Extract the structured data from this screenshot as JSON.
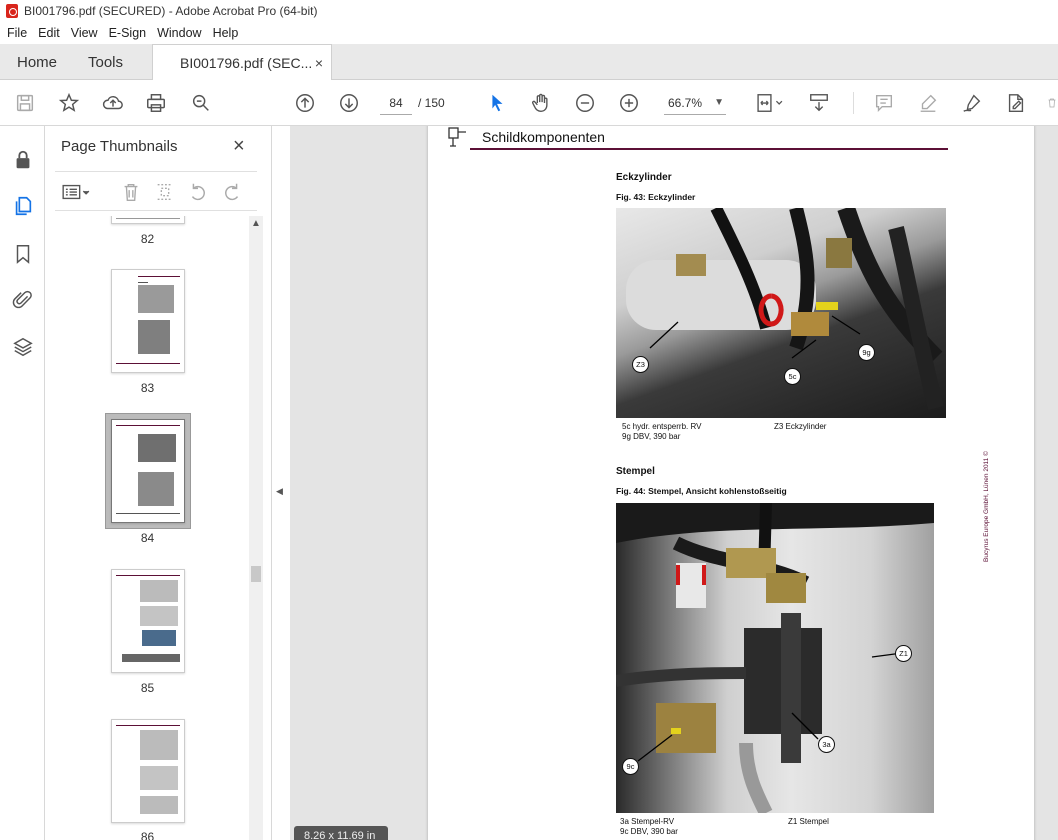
{
  "window": {
    "title": "BI001796.pdf (SECURED) - Adobe Acrobat Pro (64-bit)"
  },
  "menu": [
    "File",
    "Edit",
    "View",
    "E-Sign",
    "Window",
    "Help"
  ],
  "tabs": {
    "home": "Home",
    "tools": "Tools",
    "doc": "BI001796.pdf (SEC...",
    "close": "×"
  },
  "toolbar": {
    "page_current": "84",
    "page_total": "/ 150",
    "zoom": "66.7%",
    "zoom_caret": "▼"
  },
  "panel": {
    "title": "Page Thumbnails",
    "close": "×",
    "thumb_labels": [
      "82",
      "83",
      "84",
      "85",
      "86"
    ],
    "scroll_up": "▲"
  },
  "collapse_arrow": "◀",
  "document": {
    "header_title": "Schildkomponenten",
    "section1": {
      "title": "Eckzylinder",
      "caption": "Fig. 43:  Eckzylinder",
      "callouts": [
        "Z3",
        "5c",
        "9g"
      ],
      "legend": [
        "5c  hydr. entsperrb. RV",
        "9g  DBV, 390 bar",
        "Z3  Eckzylinder"
      ]
    },
    "section2": {
      "title": "Stempel",
      "caption": "Fig. 44:  Stempel, Ansicht kohlenstoßseitig",
      "callouts": [
        "Z1",
        "3a",
        "9c"
      ],
      "legend": [
        "3a  Stempel-RV",
        "9c  DBV, 390 bar",
        "Z1  Stempel"
      ]
    },
    "side_copyright": "Bucyrus Europe GmbH, Lünen 2011 ©",
    "page_size": "8.26 x 11.69 in"
  },
  "colors": {
    "accent_rule": "#5c1036",
    "select_blue": "#1473e6"
  }
}
